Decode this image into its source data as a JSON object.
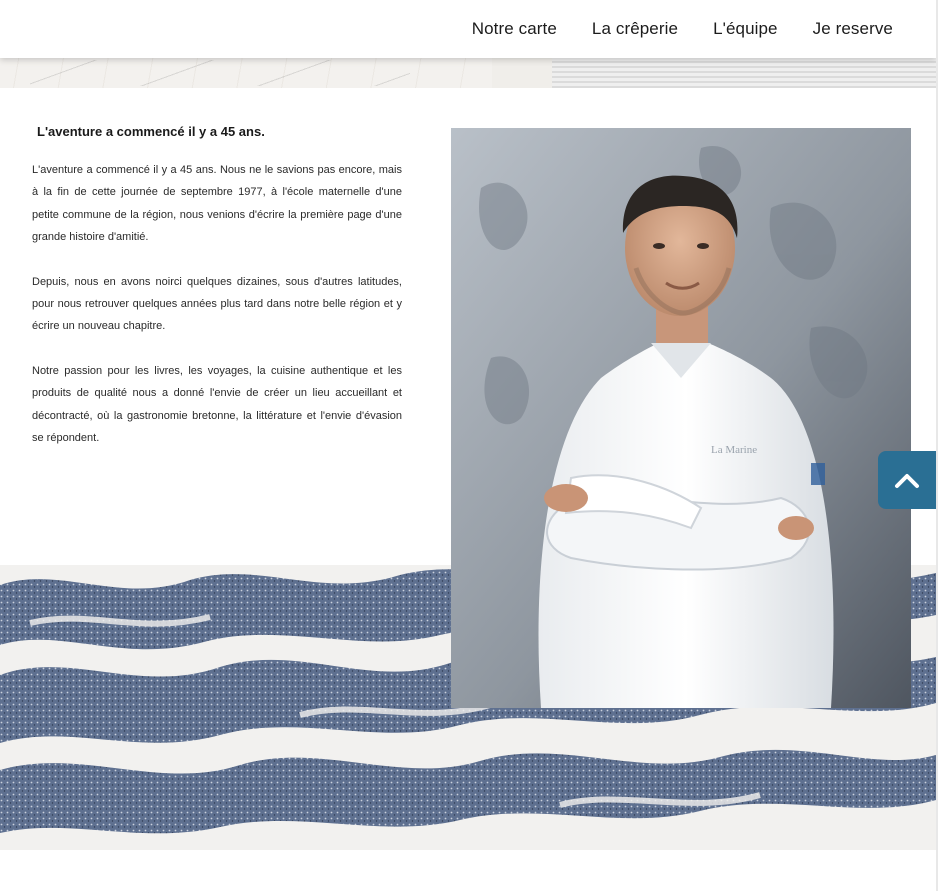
{
  "nav": {
    "items": [
      {
        "label": "Notre carte"
      },
      {
        "label": "La crêperie"
      },
      {
        "label": "L'équipe"
      },
      {
        "label": "Je reserve"
      }
    ]
  },
  "intro": {
    "title": "L'aventure a commencé il y a 45 ans.",
    "paragraphs": [
      "L'aventure a commencé il y a 45 ans. Nous ne le savions pas encore, mais à la fin de cette journée de septembre 1977, à l'école maternelle d'une petite commune de la région, nous venions d'écrire la première page d'une grande histoire d'amitié.",
      "Depuis, nous en avons noirci quelques dizaines, sous d'autres latitudes, pour nous retrouver quelques années plus tard dans notre belle région et y écrire un nouveau chapitre.",
      "Notre passion pour les livres, les voyages, la cuisine authentique et les produits de qualité nous a donné l'envie de créer un lieu accueillant et décontracté, où la gastronomie bretonne, la littérature et l'envie d'évasion se répondent."
    ]
  },
  "photo": {
    "jacket_text": "La Marine"
  },
  "icons": {
    "scroll_top": "chevron-up-icon"
  },
  "colors": {
    "accent": "#2a6f94",
    "wave_ink": "#5c6f8e",
    "wave_paper": "#f1f0ef"
  }
}
